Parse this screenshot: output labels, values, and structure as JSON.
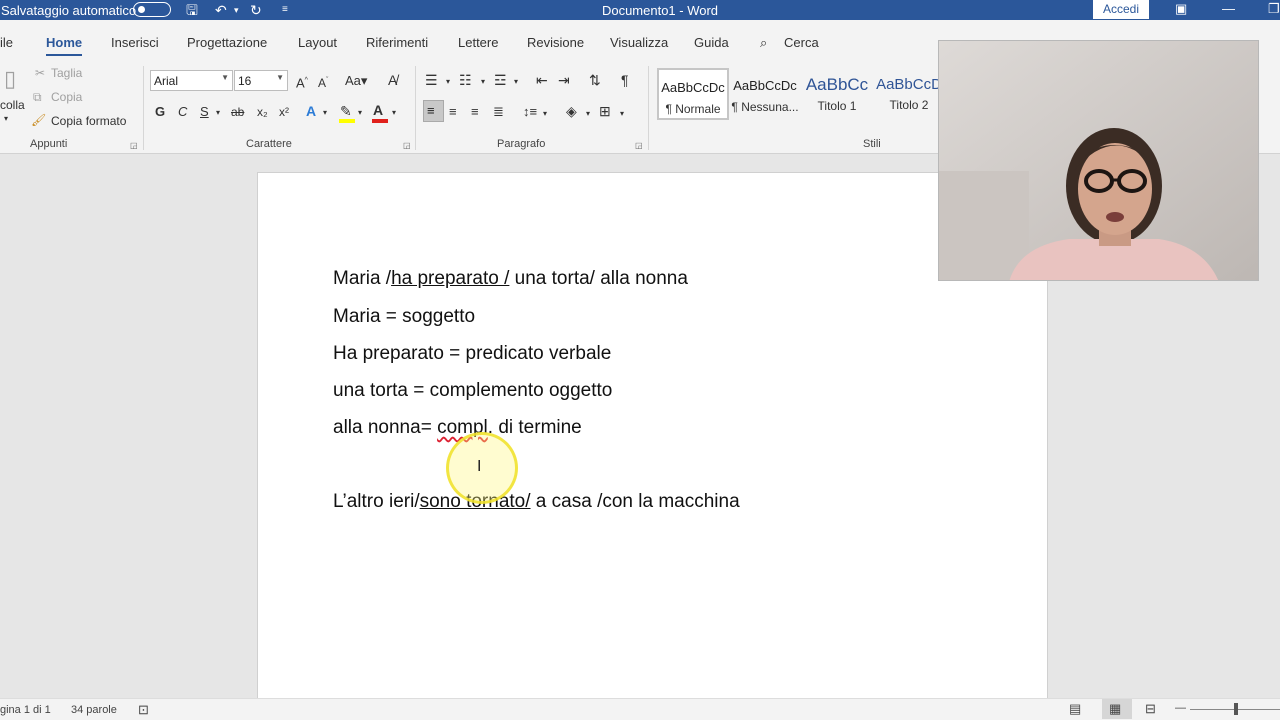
{
  "titlebar": {
    "autosave_label": "Salvataggio automatico",
    "document_title": "Documento1  -  Word",
    "signin_label": "Accedi"
  },
  "tabs": [
    "ile",
    "Home",
    "Inserisci",
    "Progettazione",
    "Layout",
    "Riferimenti",
    "Lettere",
    "Revisione",
    "Visualizza",
    "Guida",
    "Cerca"
  ],
  "active_tab": "Home",
  "clipboard": {
    "paste_label": "colla",
    "cut_label": "Taglia",
    "copy_label": "Copia",
    "format_painter_label": "Copia formato",
    "group_label": "Appunti"
  },
  "font": {
    "family_value": "Arial",
    "size_value": "16",
    "group_label": "Carattere",
    "bold_glyph": "G",
    "italic_glyph": "C",
    "underline_glyph": "S"
  },
  "paragraph": {
    "group_label": "Paragrafo"
  },
  "styles": {
    "group_label": "Stili",
    "items": [
      {
        "sample": "AaBbCcDc",
        "name": "¶ Normale"
      },
      {
        "sample": "AaBbCcDc",
        "name": "¶ Nessuna..."
      },
      {
        "sample": "AaBbCc",
        "name": "Titolo 1"
      },
      {
        "sample": "AaBbCcD",
        "name": "Titolo 2"
      }
    ]
  },
  "document": {
    "line1": {
      "pre": "Maria /",
      "underlined": "ha preparato /",
      "post": " una torta/ alla nonna"
    },
    "line2": "Maria = soggetto",
    "line3": "Ha preparato = predicato verbale",
    "line4": "una torta = complemento oggetto",
    "line5": {
      "pre": "alla nonna= ",
      "misspelled": "compl",
      "post": ". di termine"
    },
    "line6": {
      "pre": "L’altro ieri/",
      "underlined": "sono tornato/",
      "post": " a casa /con la macchina"
    }
  },
  "statusbar": {
    "page_label": "gina 1 di 1",
    "word_count": "34 parole"
  },
  "colors": {
    "word_blue": "#2b579a",
    "ribbon_bg": "#f3f3f3",
    "highlight_ring": "#f0e128"
  }
}
